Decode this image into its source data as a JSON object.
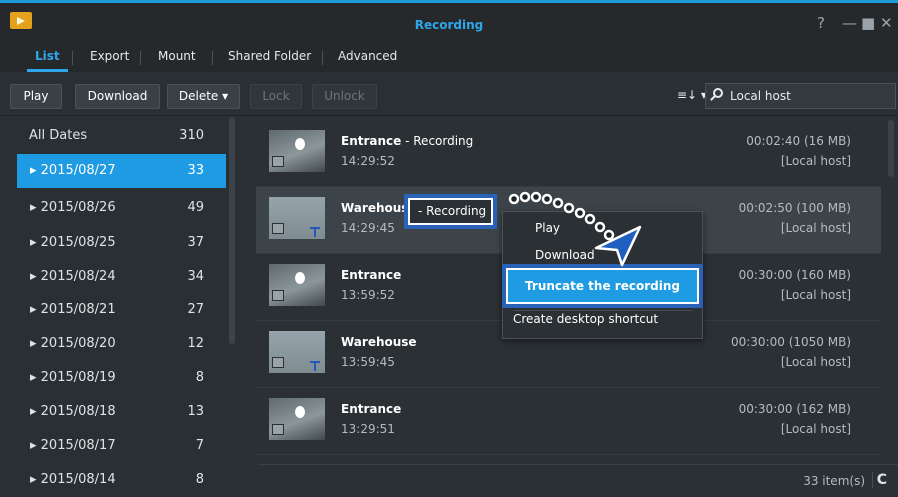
{
  "window": {
    "title": "Recording",
    "help_icon": "help-icon",
    "controls": [
      "minimize",
      "maximize",
      "close"
    ]
  },
  "tabs": [
    "List",
    "Export",
    "Mount",
    "Shared Folder",
    "Advanced"
  ],
  "toolbar": {
    "play": "Play",
    "download": "Download",
    "delete": "Delete ▾",
    "lock": "Lock",
    "unlock": "Unlock",
    "sort": "≡↓ ▾",
    "search_value": "Local host"
  },
  "sidebar": {
    "all": {
      "label": "All Dates",
      "count": "310"
    },
    "dates": [
      {
        "label": "▸ 2015/08/27",
        "count": "33"
      },
      {
        "label": "▸ 2015/08/26",
        "count": "49"
      },
      {
        "label": "▸ 2015/08/25",
        "count": "37"
      },
      {
        "label": "▸ 2015/08/24",
        "count": "34"
      },
      {
        "label": "▸ 2015/08/21",
        "count": "27"
      },
      {
        "label": "▸ 2015/08/20",
        "count": "12"
      },
      {
        "label": "▸ 2015/08/19",
        "count": "8"
      },
      {
        "label": "▸ 2015/08/18",
        "count": "13"
      },
      {
        "label": "▸ 2015/08/17",
        "count": "7"
      },
      {
        "label": "▸ 2015/08/14",
        "count": "8"
      }
    ]
  },
  "recordings": [
    {
      "name": "Entrance",
      "suffix": " - Recording",
      "time": "14:29:52",
      "duration": "00:02:40 (16 MB)",
      "host": "[Local host]"
    },
    {
      "name": "Warehous",
      "suffix": "",
      "time": "14:29:45",
      "duration": "00:02:50 (100 MB)",
      "host": "[Local host]"
    },
    {
      "name": "Entrance",
      "suffix": "",
      "time": "13:59:52",
      "duration": "00:30:00 (160 MB)",
      "host": "[Local host]"
    },
    {
      "name": "Warehouse",
      "suffix": "",
      "time": "13:59:45",
      "duration": "00:30:00 (1050 MB)",
      "host": "[Local host]"
    },
    {
      "name": "Entrance",
      "suffix": "",
      "time": "13:29:51",
      "duration": "00:30:00 (162 MB)",
      "host": "[Local host]"
    }
  ],
  "highlight_recording": "- Recording",
  "context_menu": {
    "play": "Play",
    "download": "Download",
    "truncate": "Truncate the recording",
    "shortcut": "Create desktop shortcut"
  },
  "footer": {
    "count": "33 item(s)",
    "refresh": "C"
  },
  "colors": {
    "accent": "#1e9be3",
    "highlight_border": "#2a62b7"
  }
}
